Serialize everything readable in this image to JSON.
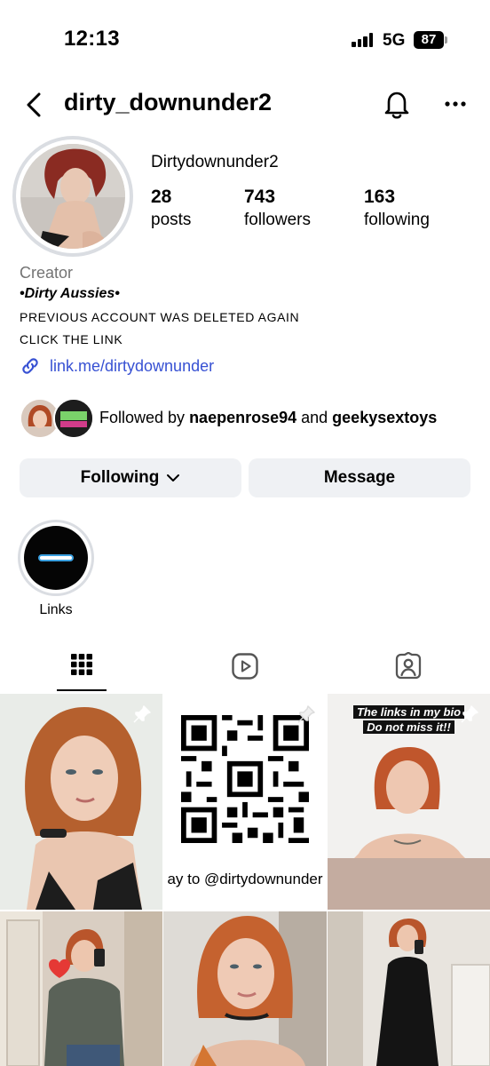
{
  "status": {
    "time": "12:13",
    "network": "5G",
    "battery": "87"
  },
  "header": {
    "username": "dirty_downunder2"
  },
  "profile": {
    "display_name": "Dirtydownunder2",
    "stats": [
      {
        "value": "28",
        "label": "posts"
      },
      {
        "value": "743",
        "label": "followers"
      },
      {
        "value": "163",
        "label": "following"
      }
    ],
    "category": "Creator",
    "bio": [
      "•Dirty Aussies•",
      "PREVIOUS ACCOUNT WAS DELETED AGAIN",
      "CLICK THE LINK"
    ],
    "link": "link.me/dirtydownunder",
    "followed_by": {
      "prefix": "Followed by ",
      "user1": "naepenrose94",
      "joiner": " and ",
      "user2": "geekysextoys"
    }
  },
  "actions": {
    "following_label": "Following",
    "message_label": "Message"
  },
  "highlights": [
    {
      "label": "Links"
    }
  ],
  "tabs": {
    "active": "grid",
    "icons": [
      "grid-icon",
      "reels-icon",
      "tagged-icon"
    ]
  },
  "grid": {
    "qr_caption": "ay to @dirtydownunder",
    "overlay_line1": "The links in my bio",
    "overlay_line2": "Do not miss it!!"
  },
  "colors": {
    "link": "#3751d3",
    "button_bg": "#eff1f4",
    "muted": "#737373"
  }
}
